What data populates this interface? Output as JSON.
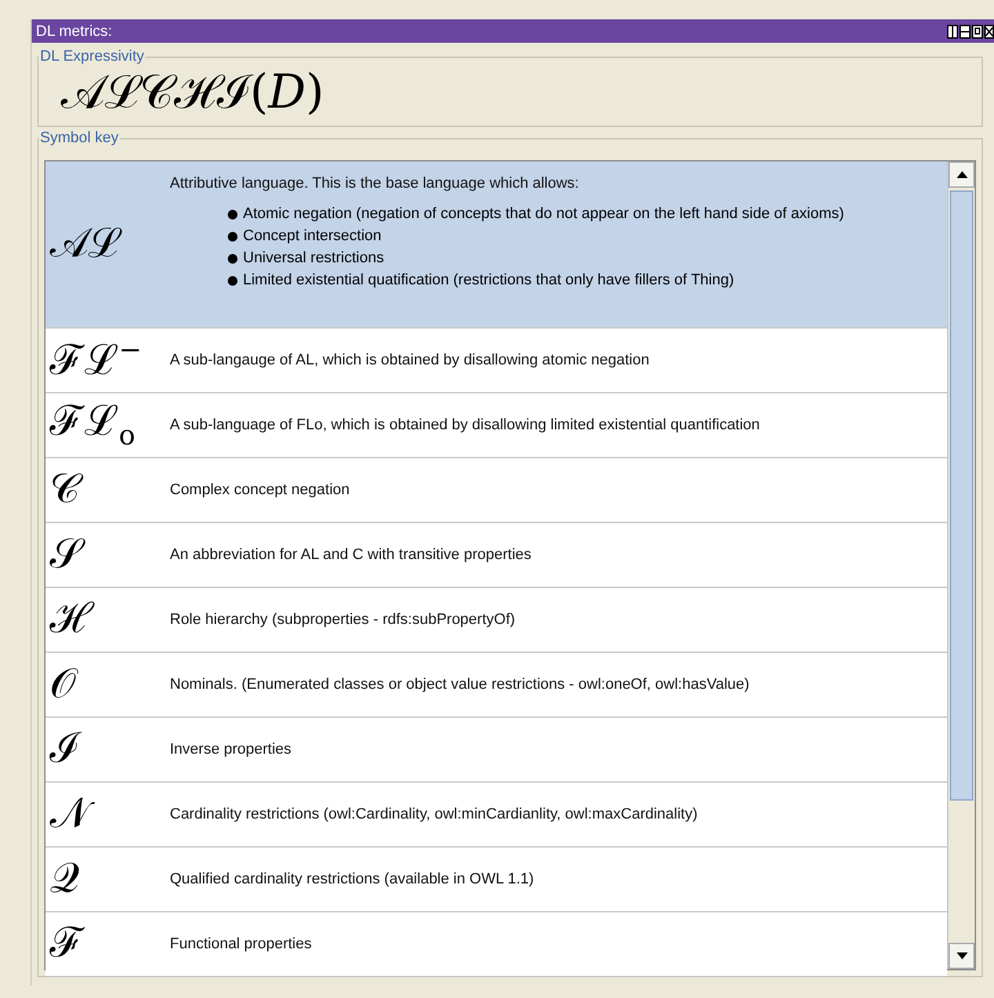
{
  "window": {
    "title": "DL metrics:"
  },
  "expressivity": {
    "legend": "DL Expressivity",
    "value": "𝒜ℒ𝒞ℋℐ(*D*)"
  },
  "symbol_key": {
    "legend": "Symbol key",
    "rows": [
      {
        "symbol": "𝒜ℒ",
        "description": "Attributive language. This is the base language which allows:",
        "bullets": [
          "Atomic negation (negation of concepts that do not appear on the left hand side of axioms)",
          "Concept intersection",
          "Universal restrictions",
          "Limited existential quatification (restrictions that only have fillers of Thing)"
        ],
        "selected": true
      },
      {
        "symbol": "ℱℒ$^{−}$",
        "description": "A sub-langauge of AL, which is obtained by disallowing atomic negation",
        "selected": false
      },
      {
        "symbol": "ℱℒ$_{o}$",
        "description": "A sub-language of FLo, which is obtained by disallowing limited existential quantification",
        "selected": false
      },
      {
        "symbol": "𝒞",
        "description": "Complex concept negation",
        "selected": false
      },
      {
        "symbol": "𝒮",
        "description": "An abbreviation for AL and C with transitive properties",
        "selected": false
      },
      {
        "symbol": "ℋ",
        "description": "Role hierarchy (subproperties - rdfs:subPropertyOf)",
        "selected": false
      },
      {
        "symbol": "𝒪",
        "description": "Nominals. (Enumerated classes or object value restrictions - owl:oneOf, owl:hasValue)",
        "selected": false
      },
      {
        "symbol": "ℐ",
        "description": "Inverse properties",
        "selected": false
      },
      {
        "symbol": "𝒩",
        "description": "Cardinality restrictions (owl:Cardinality, owl:minCardianlity, owl:maxCardinality)",
        "selected": false
      },
      {
        "symbol": "𝒬",
        "description": "Qualified cardinality restrictions (available in OWL 1.1)",
        "selected": false
      },
      {
        "symbol": "ℱ",
        "description": "Functional properties",
        "selected": false
      }
    ]
  }
}
